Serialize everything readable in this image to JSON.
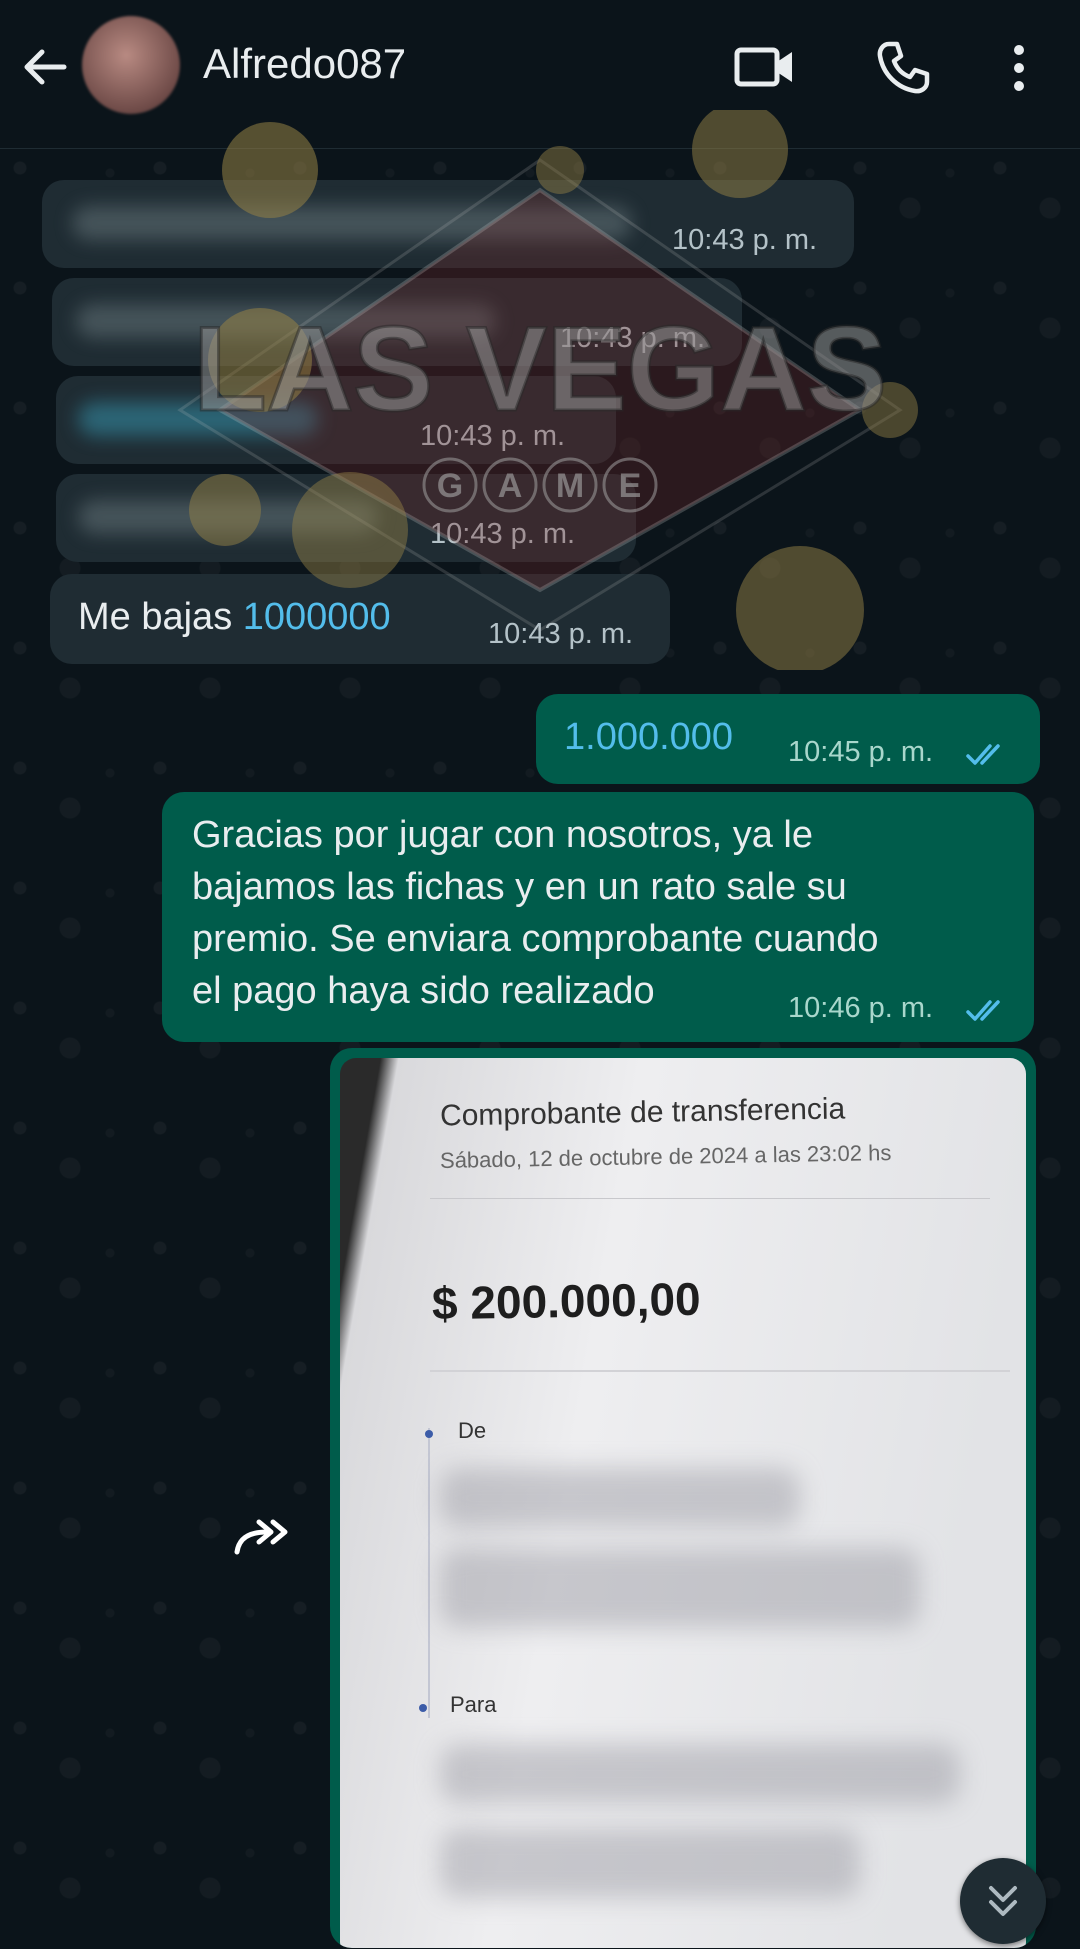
{
  "header": {
    "contact_name": "Alfredo087",
    "back_icon": "arrow-left-icon",
    "video_icon": "video-call-icon",
    "phone_icon": "phone-icon",
    "menu_icon": "more-vert-icon"
  },
  "messages": [
    {
      "direction": "in",
      "text_hidden": true,
      "time": "10:43 p. m."
    },
    {
      "direction": "in",
      "text_hidden": true,
      "time": "10:43 p. m."
    },
    {
      "direction": "in",
      "text_hidden": true,
      "time": "10:43 p. m."
    },
    {
      "direction": "in",
      "text_hidden": true,
      "time": "10:43 p. m."
    },
    {
      "direction": "in",
      "text_prefix": "Me bajas ",
      "text_number": "1000000",
      "time": "10:43 p. m."
    },
    {
      "direction": "out",
      "text": "1.000.000",
      "time": "10:45 p. m.",
      "status": "read"
    },
    {
      "direction": "out",
      "lines": [
        "Gracias por jugar con nosotros, ya le",
        "bajamos las fichas y en un rato sale su",
        "premio. Se enviara comprobante cuando",
        "el pago haya sido realizado"
      ],
      "time": "10:46 p. m.",
      "status": "read"
    }
  ],
  "receipt": {
    "title": "Comprobante de transferencia",
    "date": "Sábado, 12 de octubre de 2024 a las 23:02 hs",
    "amount": "$ 200.000,00",
    "from_label": "De",
    "to_label": "Para"
  },
  "watermark": {
    "line1": "LAS VEGAS",
    "letters": [
      "G",
      "A",
      "M",
      "E"
    ]
  },
  "colors": {
    "background": "#0b141a",
    "incoming_bubble": "#1f2c33",
    "outgoing_bubble": "#005c4b",
    "link": "#53bdeb",
    "read_ticks": "#53bdeb"
  },
  "icons": {
    "forward": "forward-icon",
    "scroll_down": "chevron-double-down-icon"
  }
}
